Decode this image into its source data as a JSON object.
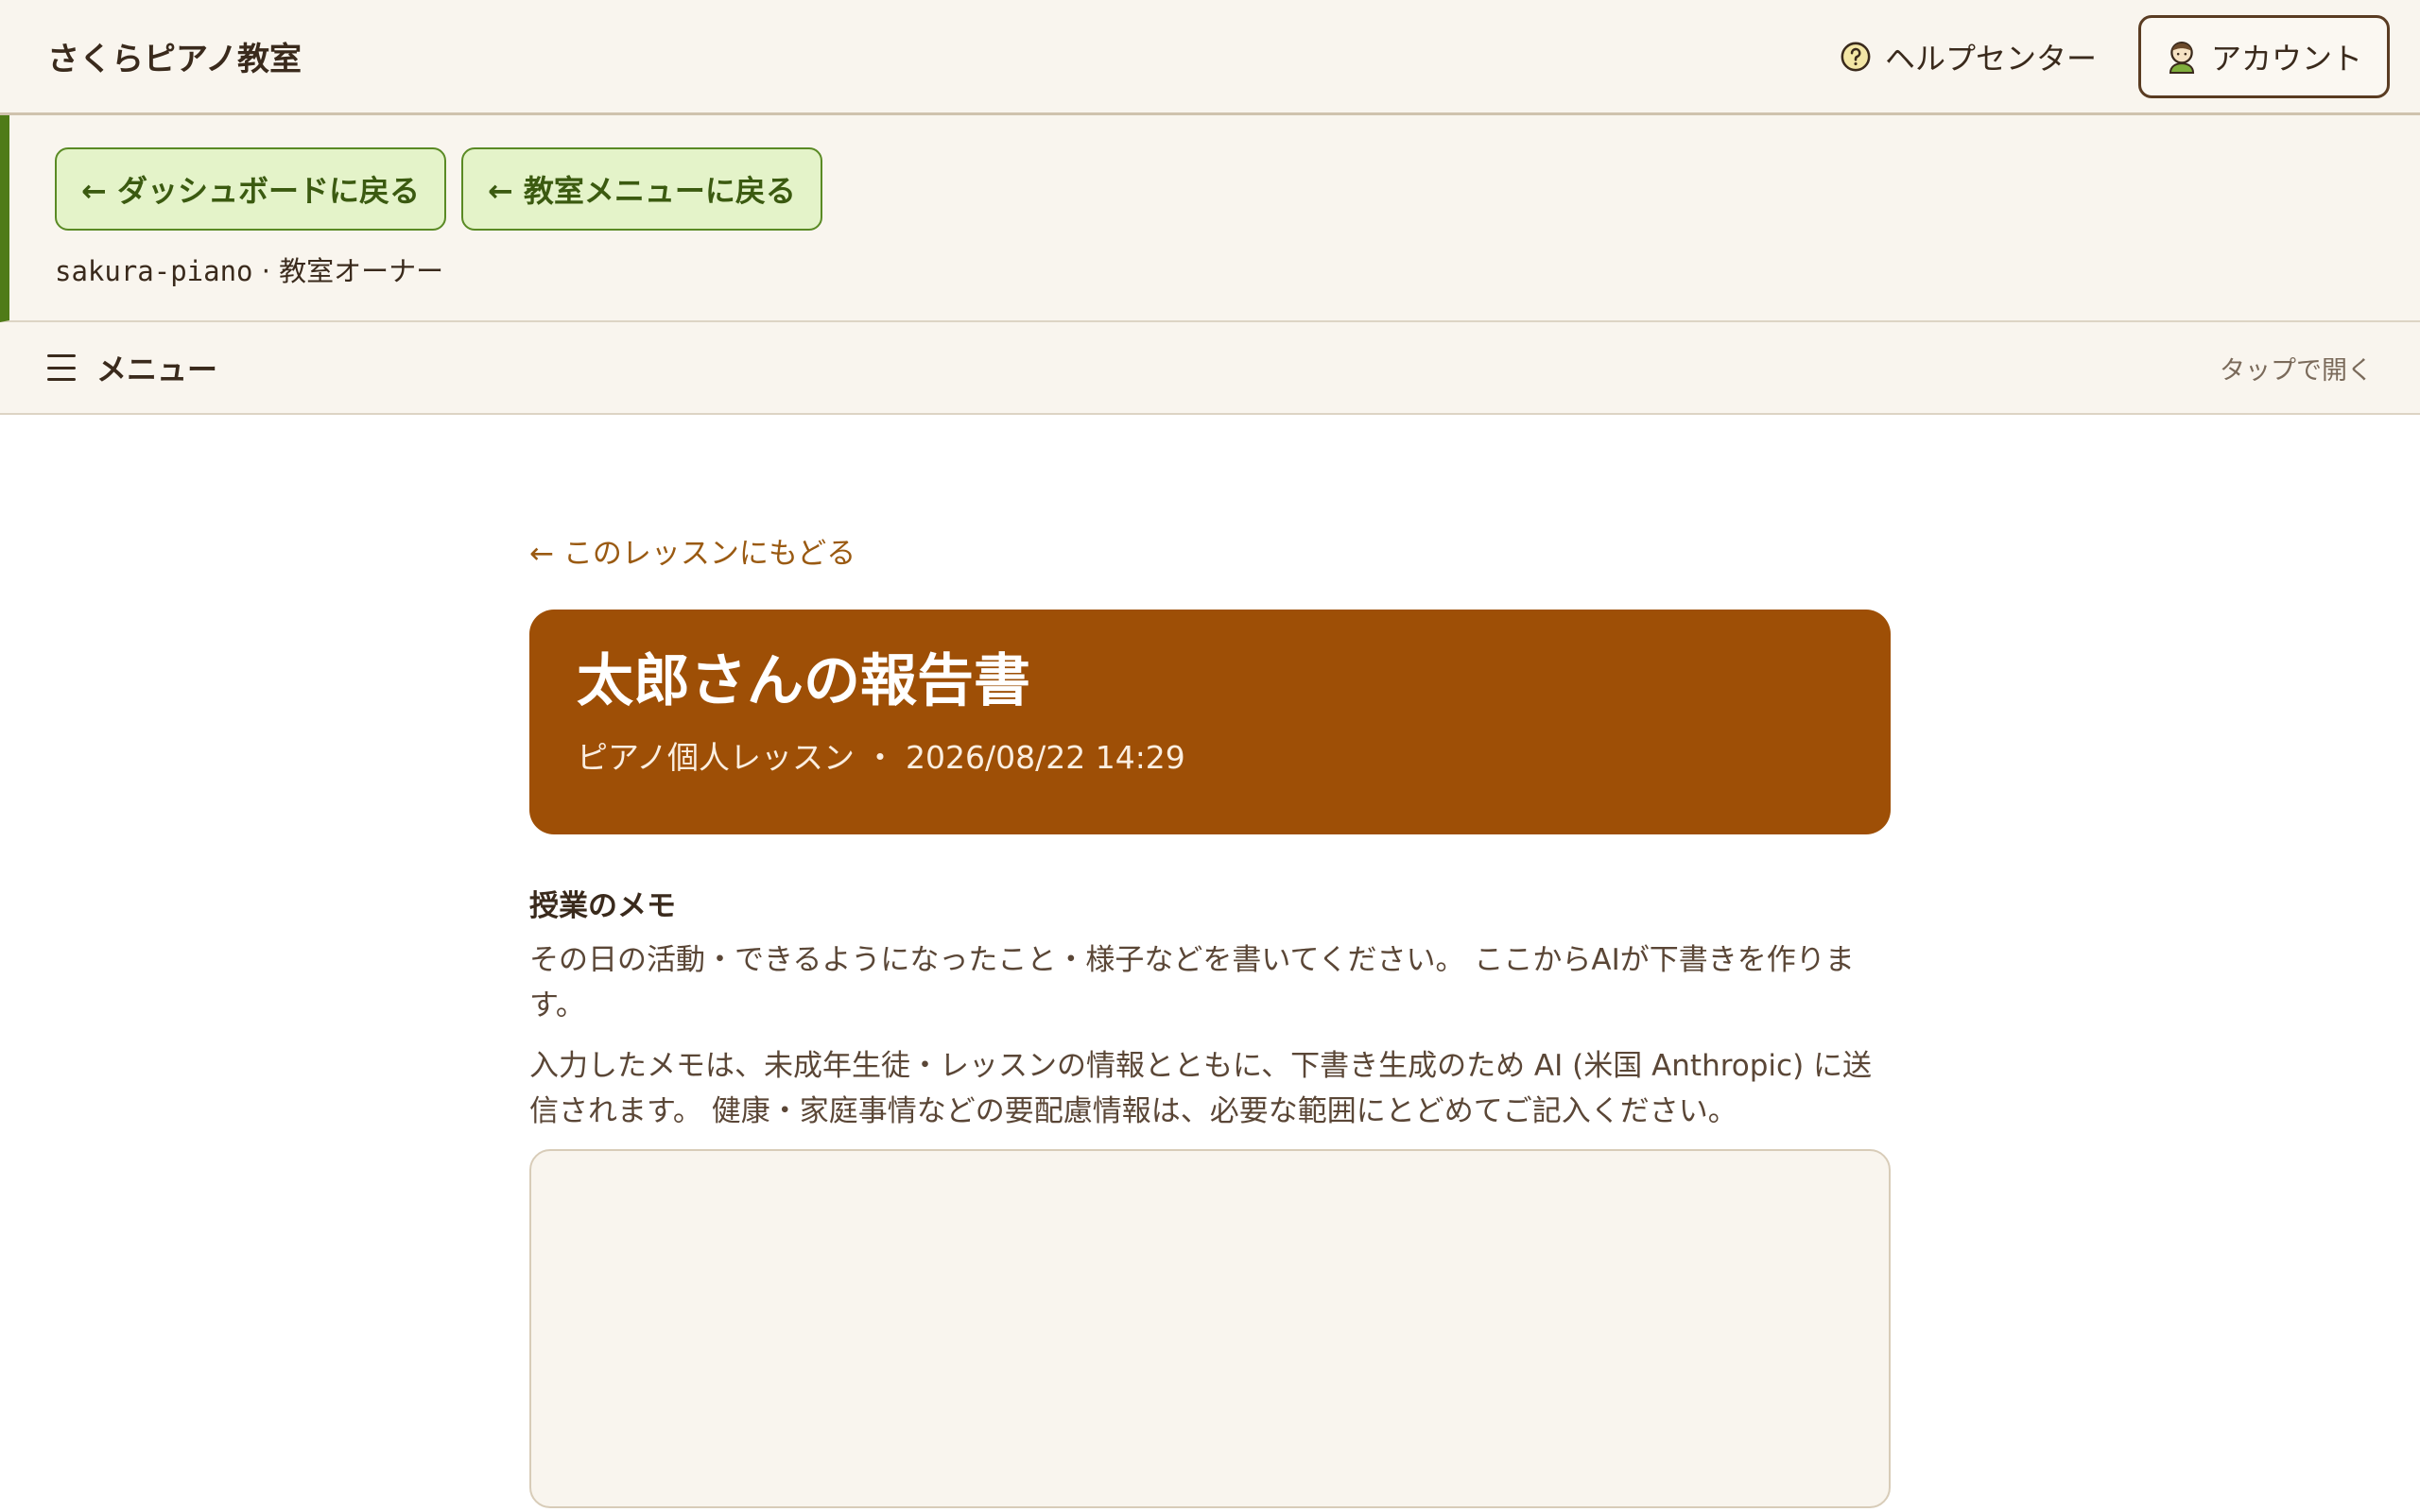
{
  "header": {
    "brand": "さくらピアノ教室",
    "help_label": "ヘルプセンター",
    "account_label": "アカウント"
  },
  "subbar": {
    "back_dashboard": "← ダッシュボードに戻る",
    "back_classroom": "← 教室メニューに戻る",
    "org_id": "sakura-piano",
    "separator": " · ",
    "role": "教室オーナー"
  },
  "menubar": {
    "label": "メニュー",
    "hint": "タップで開く"
  },
  "main": {
    "back_link": "← このレッスンにもどる",
    "report_title": "太郎さんの報告書",
    "report_subtitle": "ピアノ個人レッスン ・ 2026/08/22 14:29",
    "memo_title": "授業のメモ",
    "memo_desc": "その日の活動・できるようになったこと・様子などを書いてください。 ここからAIが下書きを作ります。",
    "privacy_note": "入力したメモは、未成年生徒・レッスンの情報とともに、下書き生成のため AI (米国 Anthropic) に送信されます。 健康・家庭事情などの要配慮情報は、必要な範囲にとどめてご記入ください。",
    "memo_value": ""
  },
  "icons": {
    "help": "help-circle-icon",
    "account": "user-avatar-icon",
    "menu": "hamburger-menu-icon"
  },
  "colors": {
    "accent_brown": "#9e4f06",
    "accent_green": "#4f7b18",
    "background_cream": "#f9f5ee"
  }
}
